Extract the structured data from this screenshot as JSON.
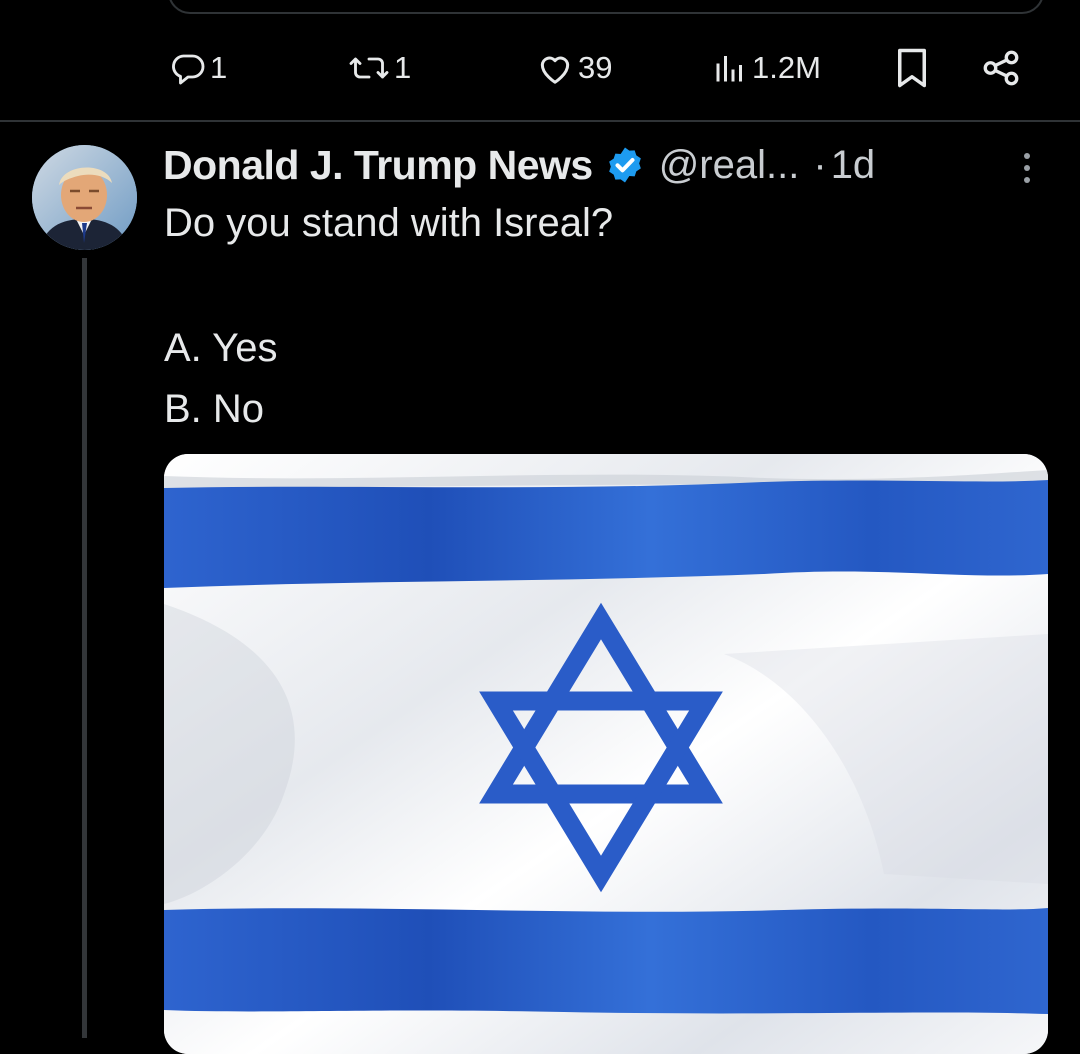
{
  "previous_tweet": {
    "actions": {
      "reply_count": "1",
      "retweet_count": "1",
      "like_count": "39",
      "view_count": "1.2M"
    }
  },
  "tweet": {
    "author": {
      "display_name": "Donald J. Trump News",
      "handle": "@real...",
      "verified": true,
      "avatar_icon": "portrait-avatar"
    },
    "separator": "·",
    "timestamp": "1d",
    "text_lines": [
      "Do you stand with Isreal?",
      "",
      "A. Yes",
      "B. No"
    ],
    "media": {
      "type": "image",
      "subject": "flag-image",
      "colors": {
        "blue": "#2a5cc8",
        "white": "#f2f4f7"
      }
    }
  },
  "colors": {
    "background": "#000000",
    "text": "#e7e9ea",
    "muted": "#c9cdd1",
    "divider": "#2f3336",
    "verified": "#1d9bf0"
  },
  "icons": [
    "reply-icon",
    "retweet-icon",
    "like-icon",
    "views-icon",
    "bookmark-icon",
    "share-icon",
    "verified-icon",
    "more-icon"
  ]
}
